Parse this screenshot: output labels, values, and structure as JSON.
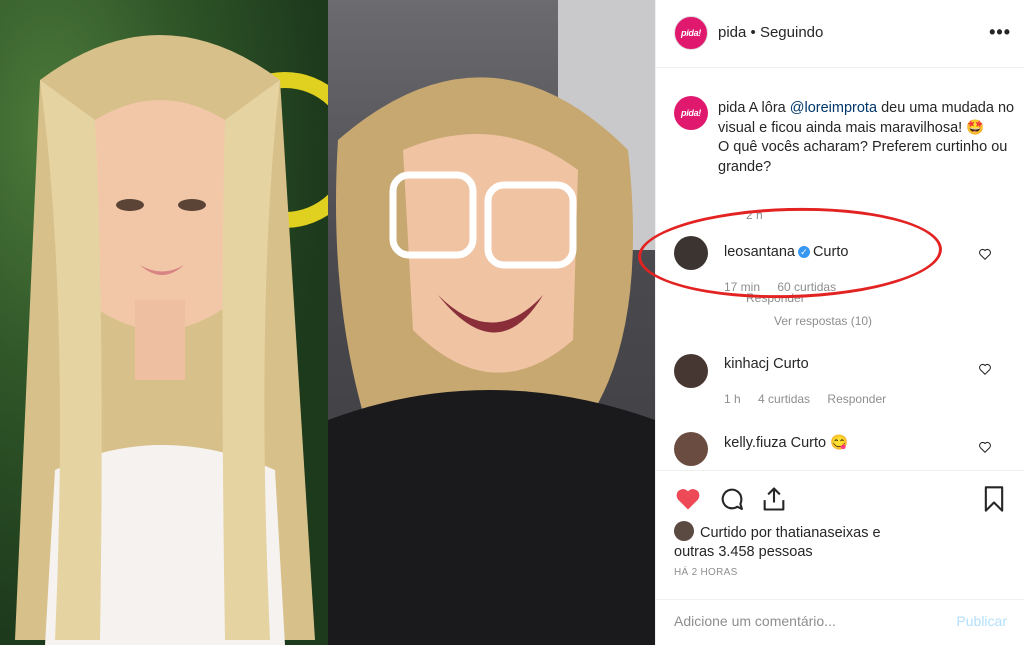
{
  "post": {
    "account": "pida",
    "follow_state": "Seguindo",
    "brand_colors": {
      "accent": "#e0196e",
      "like_red": "#ed4956",
      "link": "#00376b",
      "annotation_red": "#e32222"
    },
    "avatar_text": "pida!",
    "caption": {
      "username": "pida",
      "text_before": "A lôra",
      "mention": "@loreimprota",
      "text_after": "deu uma mudada no visual e ficou ainda mais maravilhosa! 🤩",
      "line2": "O quê vocês acharam? Preferem curtinho ou grande?",
      "time": "2 h"
    }
  },
  "comments": [
    {
      "username": "leosantana",
      "verified": true,
      "text": "Curto",
      "time": "17 min",
      "likes": "60 curtidas",
      "reply": "Responder"
    },
    {
      "username": "kinhacj",
      "verified": false,
      "text": "Curto",
      "time": "1 h",
      "likes": "4 curtidas",
      "reply": "Responder"
    },
    {
      "username": "kelly.fiuza",
      "verified": false,
      "text": "Curto 😋"
    }
  ],
  "view_replies": "Ver respostas (10)",
  "likes_block": {
    "prefix": "Curtido por",
    "user": "thatianaseixas",
    "suffix": "e",
    "others": "outras 3.458 pessoas"
  },
  "timestamp": "HÁ 2 HORAS",
  "comment_box": {
    "placeholder": "Adicione um comentário...",
    "publish": "Publicar"
  },
  "icons": [
    "more-options-icon",
    "heart-icon",
    "comment-icon",
    "share-icon",
    "bookmark-icon",
    "like-comment-icon"
  ]
}
